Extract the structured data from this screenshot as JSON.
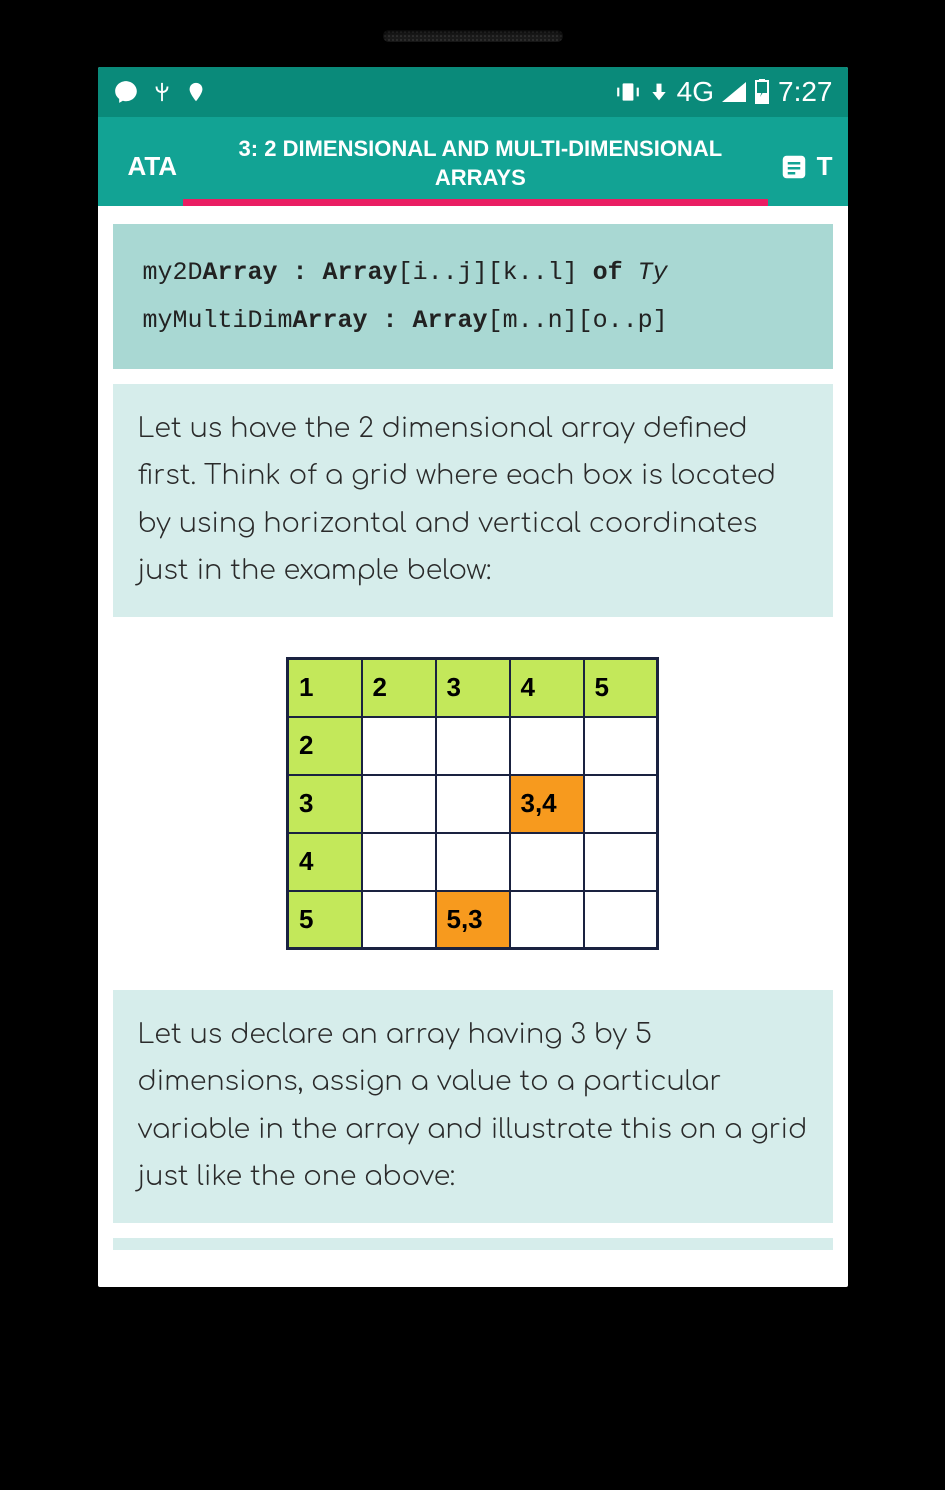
{
  "status": {
    "time": "7:27",
    "network": "4G"
  },
  "header": {
    "tab_left": "ATA",
    "tab_center": "3: 2 DIMENSIONAL AND MULTI-DIMENSIONAL ARRAYS",
    "tab_right": "T"
  },
  "code": {
    "line1_prefix": "my2D",
    "line1_bold1": "Array : Array",
    "line1_mid": "[i..j][k..l] ",
    "line1_bold2": "of ",
    "line1_italic": "Ty",
    "line2_prefix": "myMultiDim",
    "line2_bold1": "Array : Array",
    "line2_mid": "[m..n][o..p]"
  },
  "text1": "Let us have the 2 dimensional array defined first. Think of a grid where each box is located by using horizontal and vertical coordinates just in the example below:",
  "text2": "Let us declare an array having 3 by 5 dimensions, assign a value to a particular variable in the array and illustrate this on a grid just like the one above:",
  "grid": {
    "cols": [
      "1",
      "2",
      "3",
      "4",
      "5"
    ],
    "rows": [
      "2",
      "3",
      "4",
      "5"
    ],
    "cells": {
      "r3c4": "3,4",
      "r5c3": "5,3"
    }
  }
}
